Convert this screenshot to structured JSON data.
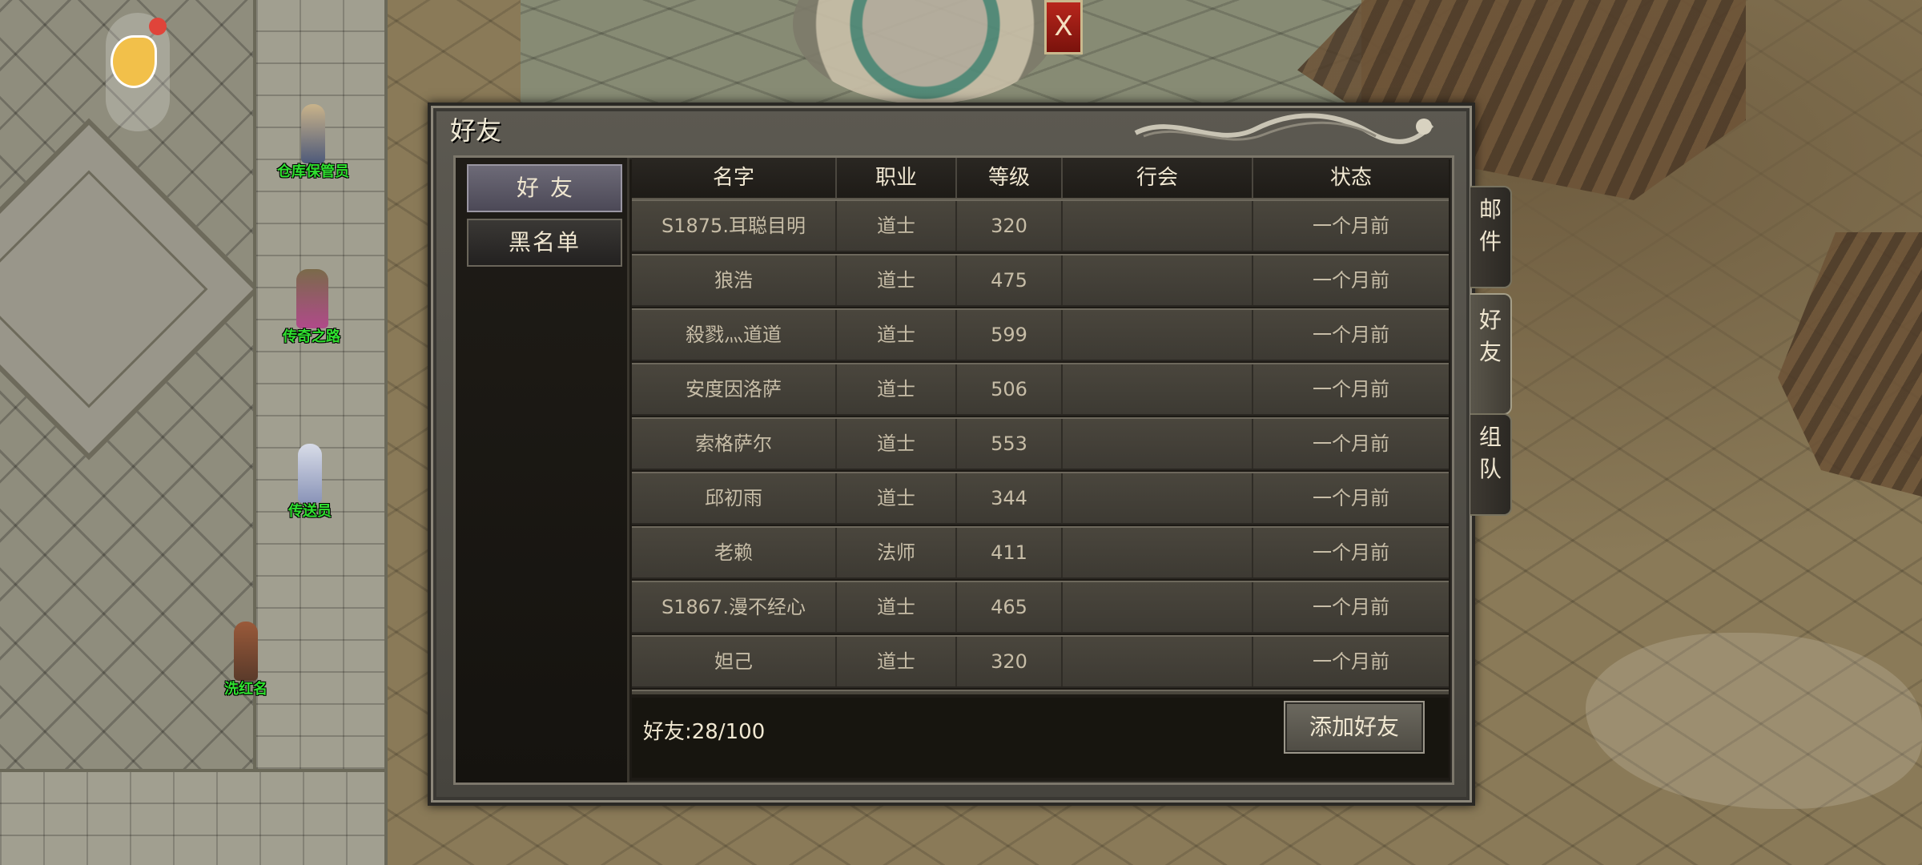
{
  "dialog": {
    "title": "好友",
    "close_label": "X",
    "categories": [
      {
        "label": "好友",
        "active": true
      },
      {
        "label": "黑名单",
        "active": false
      }
    ],
    "columns": [
      "名字",
      "职业",
      "等级",
      "行会",
      "状态"
    ],
    "rows": [
      {
        "name": "S1875.耳聪目明",
        "job": "道士",
        "level": "320",
        "guild": "",
        "status": "一个月前"
      },
      {
        "name": "狼浩",
        "job": "道士",
        "level": "475",
        "guild": "",
        "status": "一个月前"
      },
      {
        "name": "殺戮灬道道",
        "job": "道士",
        "level": "599",
        "guild": "",
        "status": "一个月前"
      },
      {
        "name": "安度因洛萨",
        "job": "道士",
        "level": "506",
        "guild": "",
        "status": "一个月前"
      },
      {
        "name": "索格萨尔",
        "job": "道士",
        "level": "553",
        "guild": "",
        "status": "一个月前"
      },
      {
        "name": "邱初雨",
        "job": "道士",
        "level": "344",
        "guild": "",
        "status": "一个月前"
      },
      {
        "name": "老赖",
        "job": "法师",
        "level": "411",
        "guild": "",
        "status": "一个月前"
      },
      {
        "name": "S1867.漫不经心",
        "job": "道士",
        "level": "465",
        "guild": "",
        "status": "一个月前"
      },
      {
        "name": "妲己",
        "job": "道士",
        "level": "320",
        "guild": "",
        "status": "一个月前"
      }
    ],
    "friend_count": "好友:28/100",
    "add_friend_label": "添加好友"
  },
  "side_tabs": [
    {
      "id": "mail",
      "chars": [
        "邮",
        "件"
      ],
      "active": false
    },
    {
      "id": "friend",
      "chars": [
        "好",
        "友"
      ],
      "active": true
    },
    {
      "id": "team",
      "chars": [
        "组",
        "队"
      ],
      "active": false
    }
  ],
  "npcs": [
    {
      "name": "仓库保管员",
      "color": "#2fe02f"
    },
    {
      "name": "传奇之路",
      "color": "#2fe02f"
    },
    {
      "name": "传送员",
      "color": "#2fe02f"
    },
    {
      "name": "洗红名",
      "color": "#2fe02f"
    }
  ],
  "notification": {
    "icon": "dolphin-icon",
    "has_badge": true
  },
  "colors": {
    "npc_name": "#2fe02f",
    "close_button": "#b8261c",
    "text_primary": "#f1e8d2",
    "text_row": "#c7bda7"
  }
}
